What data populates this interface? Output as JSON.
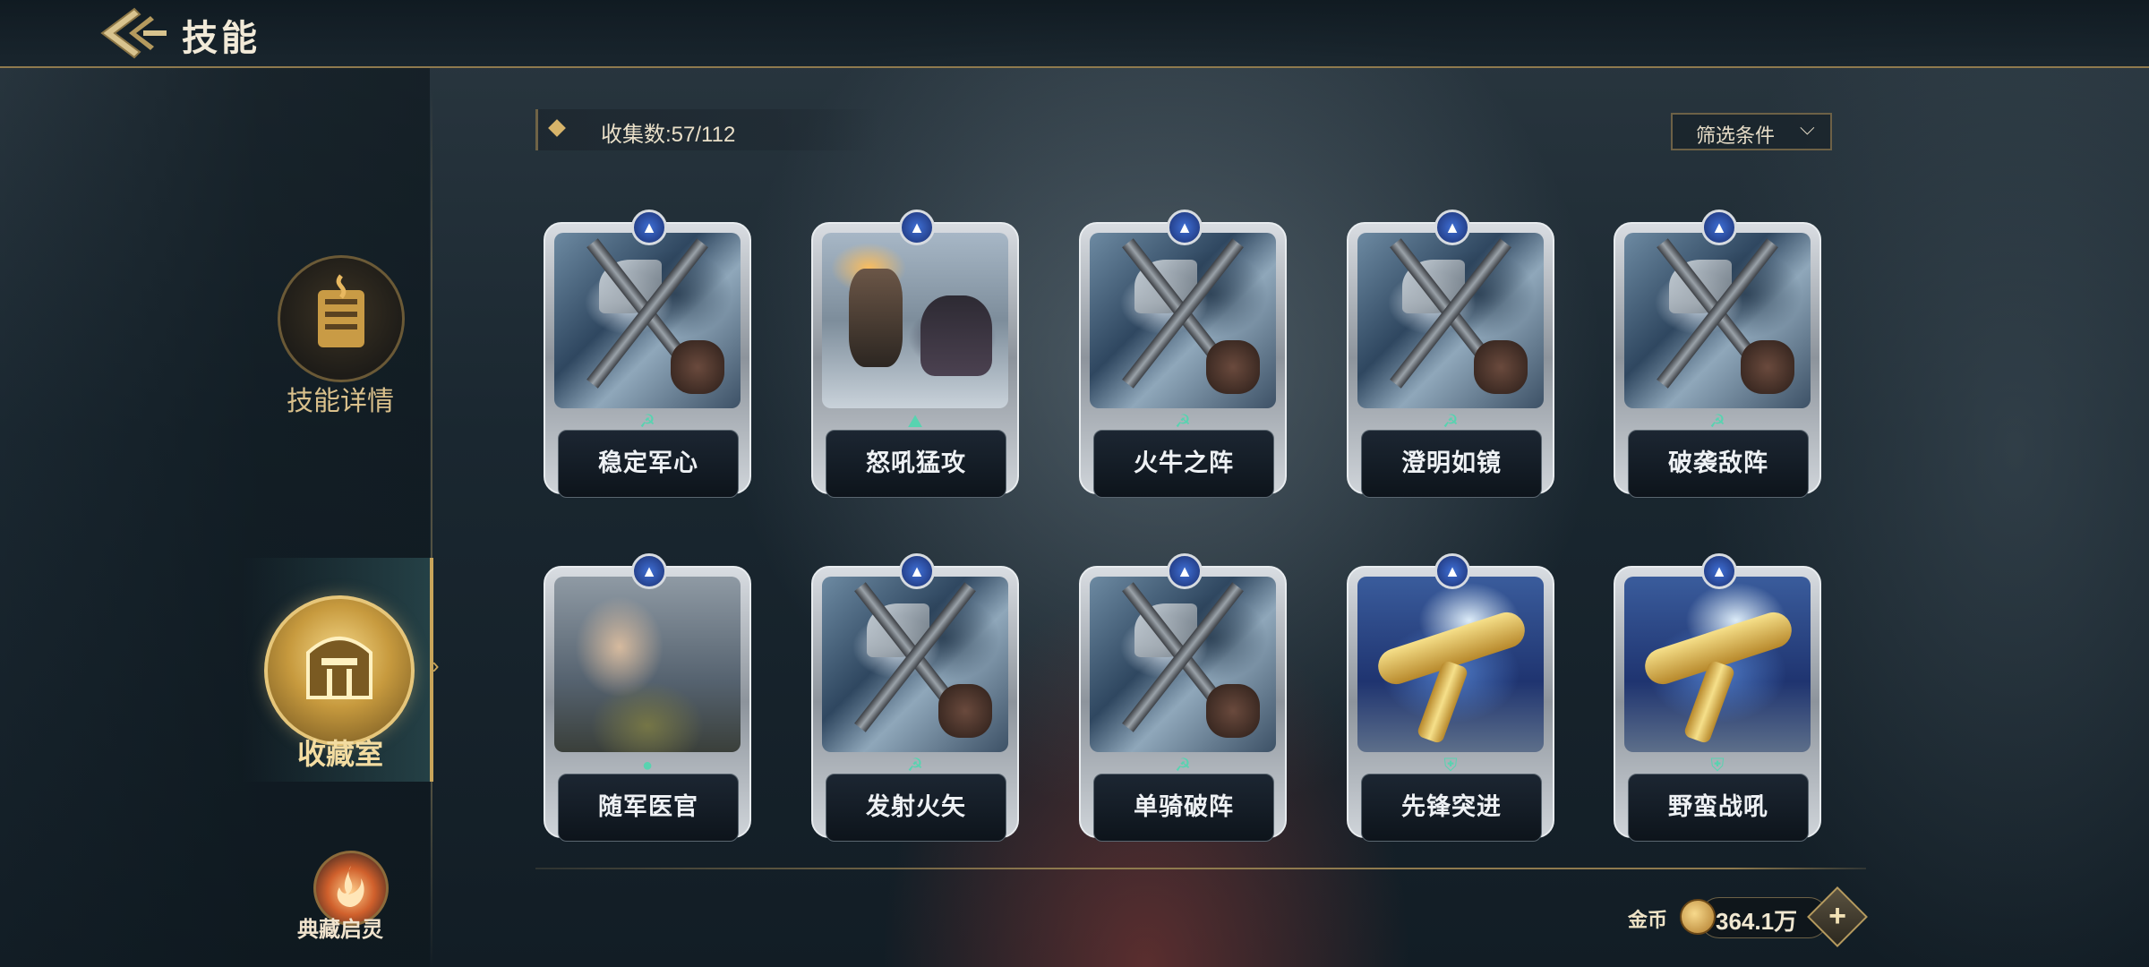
{
  "header": {
    "title": "技能"
  },
  "sidebar": {
    "items": [
      {
        "label": "技能详情",
        "icon": "scroll-emblem-icon"
      },
      {
        "label": "收藏室",
        "icon": "hall-emblem-icon",
        "selected": true
      },
      {
        "label": "典藏启灵",
        "icon": "flame-spirit-icon"
      }
    ]
  },
  "collection": {
    "count_text": "收集数:57/112"
  },
  "filter": {
    "label": "筛选条件"
  },
  "cards": [
    {
      "name": "稳定军心",
      "art": "axe",
      "type_icon": "crossed-sickle-icon"
    },
    {
      "name": "怒吼猛攻",
      "art": "chariot",
      "type_icon": "hill-icon"
    },
    {
      "name": "火牛之阵",
      "art": "axe",
      "type_icon": "crossed-sickle-icon"
    },
    {
      "name": "澄明如镜",
      "art": "axe",
      "type_icon": "crossed-sickle-icon"
    },
    {
      "name": "破袭敌阵",
      "art": "axe",
      "type_icon": "crossed-sickle-icon"
    },
    {
      "name": "随军医官",
      "art": "medic",
      "type_icon": "pin-icon"
    },
    {
      "name": "发射火矢",
      "art": "axe",
      "type_icon": "crossed-sickle-icon"
    },
    {
      "name": "单骑破阵",
      "art": "axe",
      "type_icon": "crossed-sickle-icon"
    },
    {
      "name": "先锋突进",
      "art": "eagle",
      "type_icon": "shield-icon"
    },
    {
      "name": "野蛮战吼",
      "art": "eagle",
      "type_icon": "shield-icon"
    }
  ],
  "currency": {
    "label": "金币",
    "value": "364.1万",
    "plus": "+"
  },
  "colors": {
    "accent_gold": "#c9a55a",
    "rarity_blue": "#3f6fd4",
    "type_teal": "#58d3b0"
  }
}
